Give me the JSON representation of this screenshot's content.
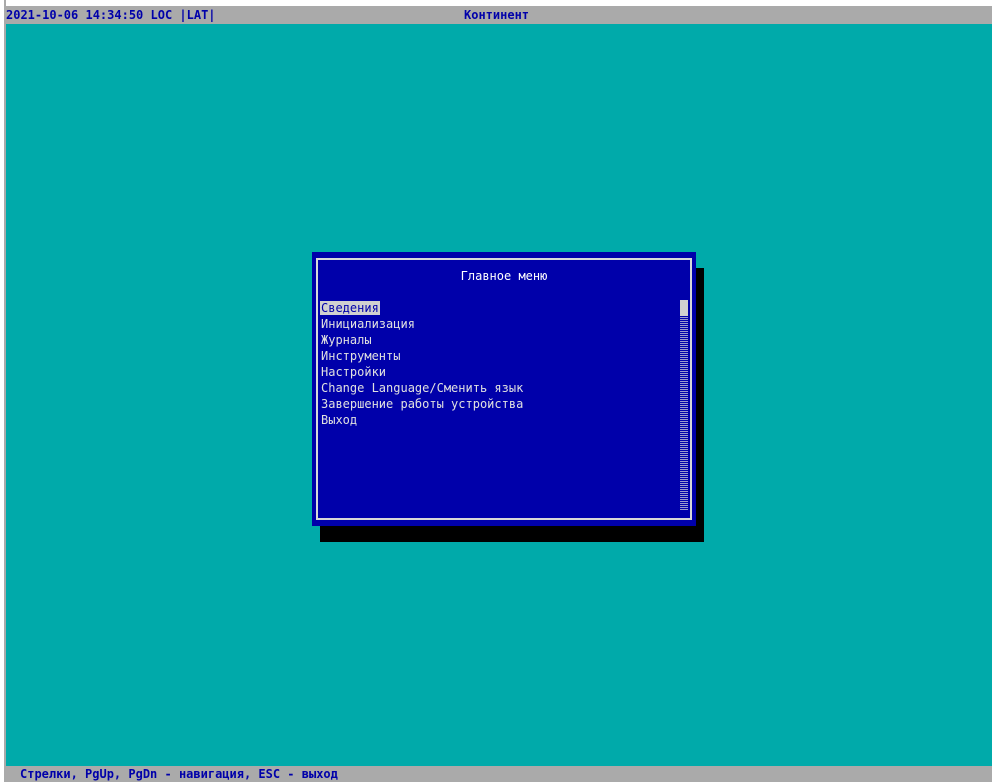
{
  "top_bar": {
    "status_text": "2021-10-06 14:34:50 LOC |LAT|",
    "app_title": "Континент"
  },
  "dialog": {
    "title": "Главное меню",
    "selected_index": 0,
    "items": [
      {
        "label": "Сведения"
      },
      {
        "label": "Инициализация"
      },
      {
        "label": "Журналы"
      },
      {
        "label": "Инструменты"
      },
      {
        "label": "Настройки"
      },
      {
        "label": "Change Language/Сменить язык"
      },
      {
        "label": "Завершение работы устройства"
      },
      {
        "label": "Выход"
      }
    ]
  },
  "bottom_bar": {
    "help_text": "Стрелки, PgUp, PgDn - навигация, ESC - выход"
  },
  "colors": {
    "background": "#00aaaa",
    "dialog": "#0000aa",
    "bars": "#aaaaaa",
    "bar_text": "#0000aa",
    "menu_text": "#e0e0e0",
    "selection": "#d0d0d0",
    "shadow": "#000000"
  }
}
